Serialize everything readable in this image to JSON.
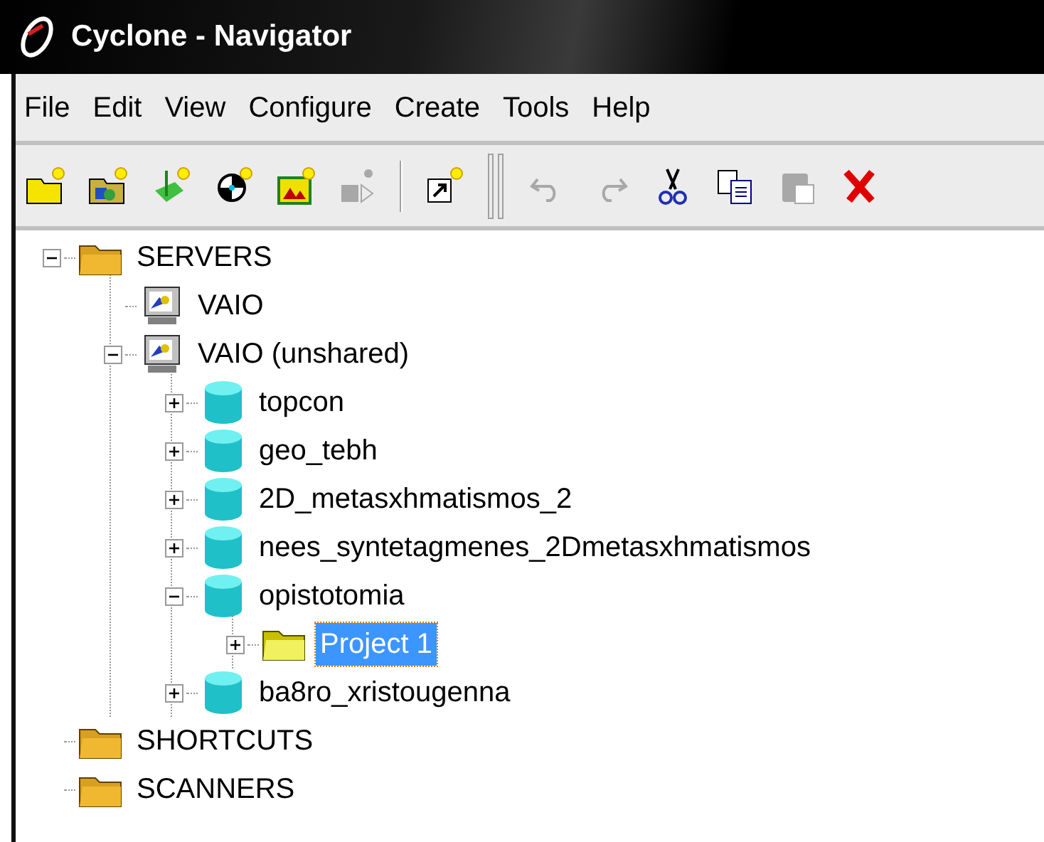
{
  "window": {
    "title": "Cyclone - Navigator"
  },
  "menu": [
    "File",
    "Edit",
    "View",
    "Configure",
    "Create",
    "Tools",
    "Help"
  ],
  "toolbar": [
    {
      "kind": "new-folder",
      "disabled": false
    },
    {
      "kind": "new-image-folder",
      "disabled": false
    },
    {
      "kind": "new-survey",
      "disabled": false
    },
    {
      "kind": "new-target",
      "disabled": false
    },
    {
      "kind": "new-picture",
      "disabled": false
    },
    {
      "kind": "new-scan",
      "disabled": true
    },
    {
      "kind": "separator"
    },
    {
      "kind": "new-shortcut",
      "disabled": false
    },
    {
      "kind": "grip"
    },
    {
      "kind": "undo",
      "disabled": true
    },
    {
      "kind": "redo",
      "disabled": true
    },
    {
      "kind": "cut",
      "disabled": false
    },
    {
      "kind": "copy",
      "disabled": false
    },
    {
      "kind": "paste",
      "disabled": true
    },
    {
      "kind": "delete",
      "disabled": false
    }
  ],
  "tree": [
    {
      "label": "SERVERS",
      "kind": "folder",
      "expanded": true,
      "selected": false,
      "children": [
        {
          "label": "VAIO",
          "kind": "server",
          "selected": false
        },
        {
          "label": "VAIO (unshared)",
          "kind": "server",
          "expanded": true,
          "selected": false,
          "children": [
            {
              "label": "topcon",
              "kind": "database",
              "expanded": false,
              "selected": false
            },
            {
              "label": "geo_tebh",
              "kind": "database",
              "expanded": false,
              "selected": false
            },
            {
              "label": "2D_metasxhmatismos_2",
              "kind": "database",
              "expanded": false,
              "selected": false
            },
            {
              "label": "nees_syntetagmenes_2Dmetasxhmatismos",
              "kind": "database",
              "expanded": false,
              "selected": false
            },
            {
              "label": "opistotomia",
              "kind": "database",
              "expanded": true,
              "selected": false,
              "children": [
                {
                  "label": "Project 1",
                  "kind": "project",
                  "expanded": false,
                  "selected": true
                }
              ]
            },
            {
              "label": "ba8ro_xristougenna",
              "kind": "database",
              "expanded": false,
              "selected": false
            }
          ]
        }
      ]
    },
    {
      "label": "SHORTCUTS",
      "kind": "folder",
      "selected": false
    },
    {
      "label": "SCANNERS",
      "kind": "folder",
      "selected": false
    }
  ]
}
